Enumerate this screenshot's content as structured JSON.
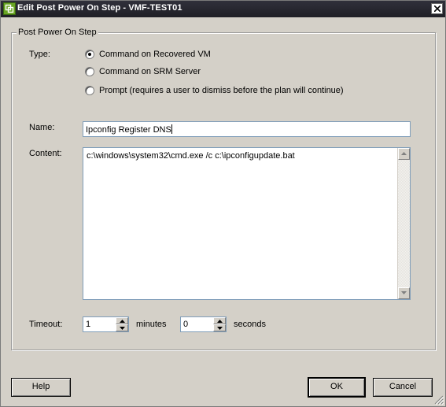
{
  "window": {
    "title": "Edit Post Power On Step - VMF-TEST01",
    "close_glyph": "✕"
  },
  "group": {
    "legend": "Post Power On Step"
  },
  "type": {
    "label": "Type:",
    "options": [
      {
        "label": "Command on Recovered VM",
        "checked": true
      },
      {
        "label": "Command on SRM Server",
        "checked": false
      },
      {
        "label": "Prompt (requires a user to dismiss before the plan will continue)",
        "checked": false
      }
    ]
  },
  "name": {
    "label": "Name:",
    "value": "Ipconfig Register DNS"
  },
  "content": {
    "label": "Content:",
    "value": "c:\\windows\\system32\\cmd.exe /c c:\\ipconfigupdate.bat"
  },
  "timeout": {
    "label": "Timeout:",
    "minutes_value": "1",
    "minutes_label": "minutes",
    "seconds_value": "0",
    "seconds_label": "seconds"
  },
  "buttons": {
    "help": "Help",
    "ok": "OK",
    "cancel": "Cancel"
  },
  "icons": {
    "app": "vmware-srm-icon",
    "close": "close-icon",
    "scroll_up": "arrow-up-icon",
    "scroll_down": "arrow-down-icon",
    "resize": "resize-grip-icon"
  },
  "colors": {
    "titlebar": "#2a2a33",
    "dialog_bg": "#d4d0c8",
    "input_border": "#7f9db9"
  }
}
